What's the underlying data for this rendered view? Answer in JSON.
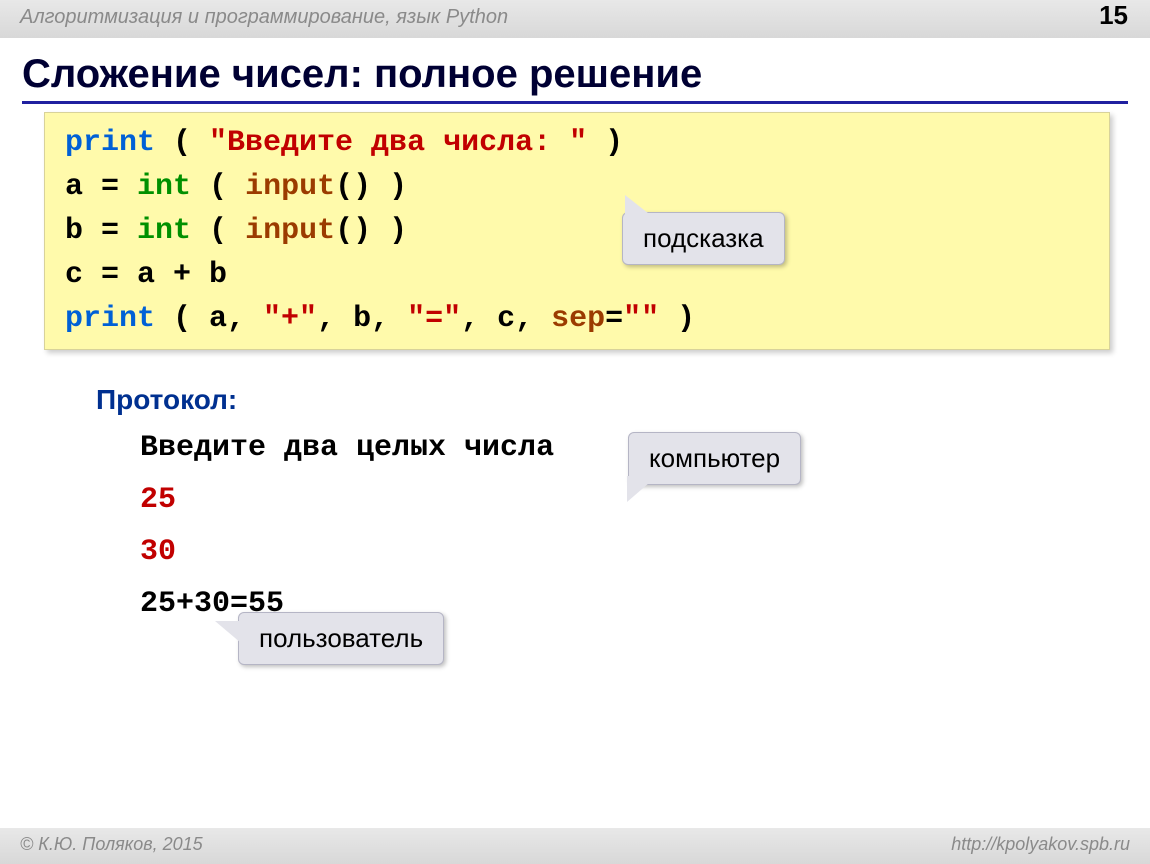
{
  "header": {
    "title": "Алгоритмизация и программирование, язык Python",
    "page": "15"
  },
  "title": "Сложение чисел: полное решение",
  "code": {
    "line1": {
      "print": "print",
      "open": " ( ",
      "str": "\"Введите два числа: \"",
      "close": " )"
    },
    "line2": {
      "a": "a",
      "eq": " = ",
      "int": "int",
      "open": " ( ",
      "input": "input",
      "paren": "()",
      "close": " )"
    },
    "line3": {
      "b": "b",
      "eq": " = ",
      "int": "int",
      "open": " ( ",
      "input": "input",
      "paren": "()",
      "close": " )"
    },
    "line4": "c = a + b",
    "line5": {
      "print": "print",
      "open": " ( a, ",
      "s1": "\"+\"",
      "m1": ", b, ",
      "s2": "\"=\"",
      "m2": ", c, ",
      "sep": "sep",
      "eq": "=",
      "empty": "\"\"",
      "close": " )"
    }
  },
  "callouts": {
    "hint": "подсказка",
    "computer": "компьютер",
    "user": "пользователь"
  },
  "protocol": {
    "label": "Протокол:",
    "prompt": "Введите два целых числа",
    "in1": "25",
    "in2": "30",
    "result": "25+30=55"
  },
  "footer": {
    "left": "© К.Ю. Поляков, 2015",
    "right": "http://kpolyakov.spb.ru"
  }
}
